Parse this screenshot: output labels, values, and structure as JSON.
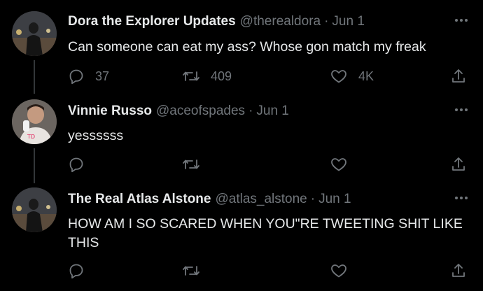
{
  "tweets": [
    {
      "name": "Dora the Explorer Updates",
      "handle": "@therealdora",
      "separator": "·",
      "date": "Jun 1",
      "text": "Can someone can eat my ass? Whose gon match my freak",
      "replies": "37",
      "retweets": "409",
      "likes": "4K"
    },
    {
      "name": "Vinnie Russo",
      "handle": "@aceofspades",
      "separator": "·",
      "date": "Jun 1",
      "text": "yessssss",
      "replies": "",
      "retweets": "",
      "likes": ""
    },
    {
      "name": "The Real Atlas Alstone",
      "handle": "@atlas_alstone",
      "separator": "·",
      "date": "Jun 1",
      "text": "HOW AM I SO SCARED WHEN YOU\"RE TWEETING SHIT LIKE THIS",
      "replies": "",
      "retweets": "",
      "likes": ""
    }
  ],
  "icons": {
    "reply": "reply-icon",
    "retweet": "retweet-icon",
    "like": "heart-icon",
    "share": "share-icon",
    "more": "more-icon"
  },
  "colors": {
    "background": "#000000",
    "primary_text": "#e7e9ea",
    "secondary_text": "#71767b",
    "thread_line": "#333639"
  }
}
